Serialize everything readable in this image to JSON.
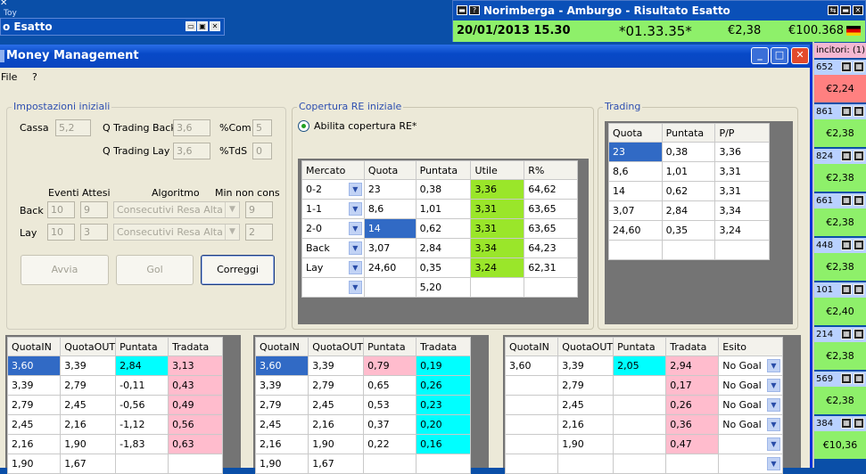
{
  "desktop": {
    "toy_label": "Toy"
  },
  "bg_window": {
    "title": "o Esatto"
  },
  "event_window": {
    "title": "Norimberga - Amburgo - Risultato Esatto",
    "date": "20/01/2013  15.30",
    "timer": "*01.33.35*",
    "amount1": "€2,38",
    "amount2": "€100.368",
    "colors": {
      "titlebar": "#0a50b8",
      "info_bg": "#8ef06a"
    }
  },
  "right_panel": {
    "header": "incitori: (1)",
    "rows": [
      {
        "id": "652",
        "value": "€2,24",
        "color": "#ff8080"
      },
      {
        "id": "861",
        "value": "€2,38",
        "color": "#8ef06a"
      },
      {
        "id": "824",
        "value": "€2,38",
        "color": "#8ef06a"
      },
      {
        "id": "661",
        "value": "€2,38",
        "color": "#8ef06a"
      },
      {
        "id": "448",
        "value": "€2,38",
        "color": "#8ef06a"
      },
      {
        "id": "101",
        "value": "€2,40",
        "color": "#8ef06a"
      },
      {
        "id": "214",
        "value": "€2,38",
        "color": "#8ef06a"
      },
      {
        "id": "569",
        "value": "€2,38",
        "color": "#8ef06a"
      },
      {
        "id": "384",
        "value": "€10,36",
        "color": "#8ef06a"
      }
    ]
  },
  "main_window": {
    "title": "Money Management",
    "menu": [
      "File",
      "?"
    ],
    "impostazioni": {
      "title": "Impostazioni iniziali",
      "cassa_label": "Cassa",
      "cassa_value": "5,2",
      "qtb_label": "Q Trading Back",
      "qtb_value": "3,6",
      "com_label": "%Com",
      "com_value": "5",
      "qtl_label": "Q Trading Lay",
      "qtl_value": "3,6",
      "tds_label": "%TdS",
      "tds_value": "0",
      "col_eventi": "Eventi",
      "col_attesi": "Attesi",
      "col_algoritmo": "Algoritmo",
      "col_min": "Min non cons",
      "back_label": "Back",
      "back_eventi": "10",
      "back_attesi": "9",
      "back_algo": "Consecutivi Resa Alta",
      "back_min": "9",
      "lay_label": "Lay",
      "lay_eventi": "10",
      "lay_attesi": "3",
      "lay_algo": "Consecutivi Resa Alta",
      "lay_min": "2",
      "btn_avvia": "Avvia",
      "btn_gol": "Gol",
      "btn_correggi": "Correggi"
    },
    "copertura": {
      "title": "Copertura RE iniziale",
      "radio_label": "Abilita copertura RE*",
      "headers": [
        "Mercato",
        "Quota",
        "Puntata",
        "Utile",
        "R%"
      ],
      "rows": [
        [
          "0-2",
          "23",
          "0,38",
          "3,36",
          "64,62"
        ],
        [
          "1-1",
          "8,6",
          "1,01",
          "3,31",
          "63,65"
        ],
        [
          "2-0",
          "14",
          "0,62",
          "3,31",
          "63,65"
        ],
        [
          "Back",
          "3,07",
          "2,84",
          "3,34",
          "64,23"
        ],
        [
          "Lay",
          "24,60",
          "0,35",
          "3,24",
          "62,31"
        ],
        [
          "",
          "",
          "5,20",
          "",
          ""
        ]
      ]
    },
    "trading": {
      "title": "Trading",
      "headers": [
        "Quota",
        "Puntata",
        "P/P"
      ],
      "rows": [
        [
          "23",
          "0,38",
          "3,36"
        ],
        [
          "8,6",
          "1,01",
          "3,31"
        ],
        [
          "14",
          "0,62",
          "3,31"
        ],
        [
          "3,07",
          "2,84",
          "3,34"
        ],
        [
          "24,60",
          "0,35",
          "3,24"
        ],
        [
          "",
          "",
          ""
        ]
      ]
    },
    "grid1": {
      "headers": [
        "QuotaIN",
        "QuotaOUT",
        "Puntata",
        "Tradata"
      ],
      "rows": [
        [
          "3,60",
          "3,39",
          "2,84",
          "3,13"
        ],
        [
          "3,39",
          "2,79",
          "-0,11",
          "0,43"
        ],
        [
          "2,79",
          "2,45",
          "-0,56",
          "0,49"
        ],
        [
          "2,45",
          "2,16",
          "-1,12",
          "0,56"
        ],
        [
          "2,16",
          "1,90",
          "-1,83",
          "0,63"
        ],
        [
          "1,90",
          "1,67",
          "",
          ""
        ]
      ]
    },
    "grid2": {
      "headers": [
        "QuotaIN",
        "QuotaOUT",
        "Puntata",
        "Tradata"
      ],
      "rows": [
        [
          "3,60",
          "3,39",
          "0,79",
          "0,19"
        ],
        [
          "3,39",
          "2,79",
          "0,65",
          "0,26"
        ],
        [
          "2,79",
          "2,45",
          "0,53",
          "0,23"
        ],
        [
          "2,45",
          "2,16",
          "0,37",
          "0,20"
        ],
        [
          "2,16",
          "1,90",
          "0,22",
          "0,16"
        ],
        [
          "1,90",
          "1,67",
          "",
          ""
        ]
      ]
    },
    "grid3": {
      "headers": [
        "QuotaIN",
        "QuotaOUT",
        "Puntata",
        "Tradata",
        "Esito"
      ],
      "rows": [
        [
          "3,60",
          "3,39",
          "2,05",
          "2,94",
          "No Goal"
        ],
        [
          "",
          "2,79",
          "",
          "0,17",
          "No Goal"
        ],
        [
          "",
          "2,45",
          "",
          "0,26",
          "No Goal"
        ],
        [
          "",
          "2,16",
          "",
          "0,36",
          "No Goal"
        ],
        [
          "",
          "1,90",
          "",
          "0,47",
          ""
        ],
        [
          "",
          "",
          "",
          "",
          ""
        ]
      ]
    }
  }
}
